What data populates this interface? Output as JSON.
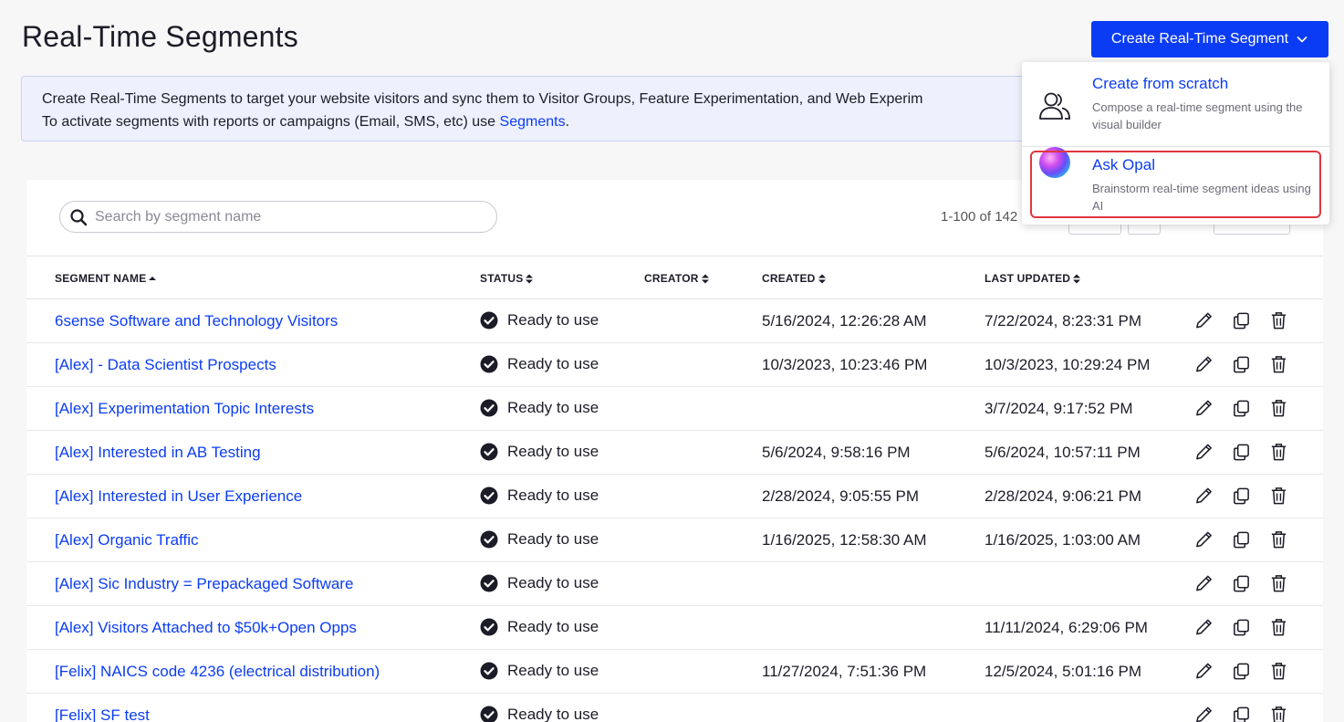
{
  "header": {
    "title": "Real-Time Segments",
    "create_button_label": "Create Real-Time Segment"
  },
  "banner": {
    "line1": "Create Real-Time Segments to target your website visitors and sync them to Visitor Groups, Feature Experimentation, and Web Experim",
    "line2_prefix": "To activate segments with reports or campaigns (Email, SMS, etc) use ",
    "line2_link": "Segments",
    "line2_suffix": "."
  },
  "search": {
    "placeholder": "Search by segment name"
  },
  "pager": {
    "range_text": "1-100 of 142"
  },
  "table": {
    "columns": {
      "name": "SEGMENT NAME",
      "status": "STATUS",
      "creator": "CREATOR",
      "created": "CREATED",
      "updated": "LAST UPDATED"
    },
    "rows": [
      {
        "name": "6sense Software and Technology Visitors",
        "status": "Ready to use",
        "created": "5/16/2024, 12:26:28 AM",
        "updated": "7/22/2024, 8:23:31 PM"
      },
      {
        "name": "[Alex] - Data Scientist Prospects",
        "status": "Ready to use",
        "created": "10/3/2023, 10:23:46 PM",
        "updated": "10/3/2023, 10:29:24 PM"
      },
      {
        "name": "[Alex] Experimentation Topic Interests",
        "status": "Ready to use",
        "created": "",
        "updated": "3/7/2024, 9:17:52 PM"
      },
      {
        "name": "[Alex] Interested in AB Testing",
        "status": "Ready to use",
        "created": "5/6/2024, 9:58:16 PM",
        "updated": "5/6/2024, 10:57:11 PM"
      },
      {
        "name": "[Alex] Interested in User Experience",
        "status": "Ready to use",
        "created": "2/28/2024, 9:05:55 PM",
        "updated": "2/28/2024, 9:06:21 PM"
      },
      {
        "name": "[Alex] Organic Traffic",
        "status": "Ready to use",
        "created": "1/16/2025, 12:58:30 AM",
        "updated": "1/16/2025, 1:03:00 AM"
      },
      {
        "name": "[Alex] Sic Industry = Prepackaged Software",
        "status": "Ready to use",
        "created": "",
        "updated": ""
      },
      {
        "name": "[Alex] Visitors Attached to $50k+Open Opps",
        "status": "Ready to use",
        "created": "",
        "updated": "11/11/2024, 6:29:06 PM"
      },
      {
        "name": "[Felix] NAICS code 4236 (electrical distribution)",
        "status": "Ready to use",
        "created": "11/27/2024, 7:51:36 PM",
        "updated": "12/5/2024, 5:01:16 PM"
      },
      {
        "name": "[Felix] SF test",
        "status": "Ready to use",
        "created": "",
        "updated": ""
      }
    ]
  },
  "dropdown": {
    "items": [
      {
        "title": "Create from scratch",
        "desc": "Compose a real-time segment using the visual builder",
        "icon": "users-icon"
      },
      {
        "title": "Ask Opal",
        "desc": "Brainstorm real-time segment ideas using AI",
        "icon": "opal-orb-icon"
      }
    ]
  },
  "colors": {
    "accent": "#0b3cf5",
    "highlight": "#e0363f"
  }
}
